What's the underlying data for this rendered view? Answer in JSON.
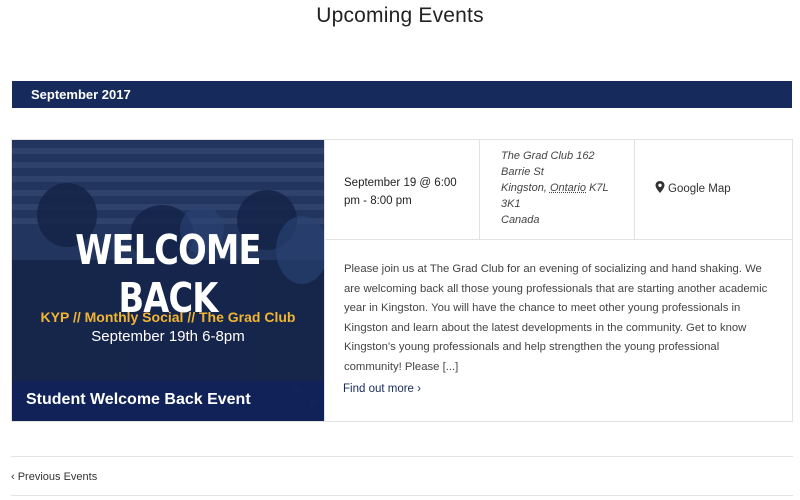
{
  "page": {
    "title": "Upcoming Events"
  },
  "month": {
    "label": "September 2017"
  },
  "event": {
    "image": {
      "headline": "WELCOME BACK",
      "subheadline": "KYP // Monthly Social // The Grad Club",
      "date_text": "September 19th 6-8pm",
      "caption": "Student Welcome Back Event",
      "accent_color": "#f2b533",
      "overlay_color": "#1b2d55"
    },
    "time_line1": "September 19 @ 6:00",
    "time_line2": "pm - 8:00 pm",
    "venue": {
      "line1": "The Grad Club 162",
      "line2": "Barrie St",
      "city": "Kingston,",
      "province": "Ontario",
      "postal_a": "K7L",
      "postal_b": "3K1",
      "country": "Canada"
    },
    "map": {
      "icon": "map-marker-icon",
      "label": "Google Map"
    },
    "description": "Please join us at The Grad Club for an evening of socializing and hand shaking. We are welcoming back all those young professionals that are starting another academic year in Kingston. You will have the chance to meet other young professionals in Kingston and learn about the latest developments in the community. Get to know Kingston's young professionals and help strengthen the young professional community!   Please [...]",
    "read_more": "Find out more ›"
  },
  "navigation": {
    "previous": "‹ Previous Events"
  },
  "colors": {
    "brand_navy": "#172a5c",
    "border": "#e2e2e2"
  }
}
